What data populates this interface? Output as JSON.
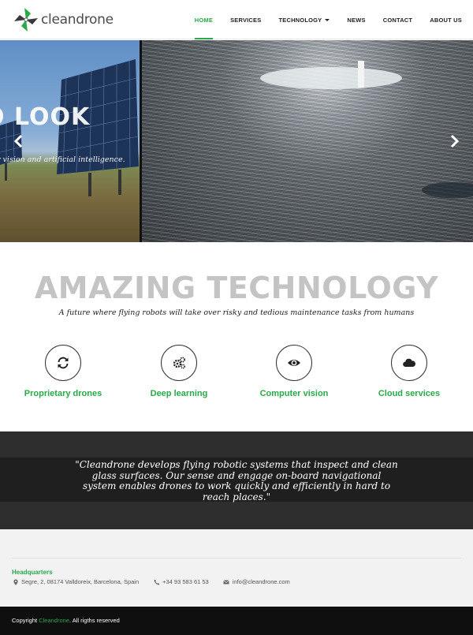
{
  "brand": {
    "name": "cleandrone"
  },
  "nav": {
    "items": [
      {
        "label": "HOME",
        "active": true
      },
      {
        "label": "SERVICES"
      },
      {
        "label": "TECHNOLOGY",
        "dropdown": true
      },
      {
        "label": "NEWS"
      },
      {
        "label": "CONTACT"
      },
      {
        "label": "ABOUT US"
      }
    ]
  },
  "hero": {
    "title": "O LOOK",
    "subtitle": "r vision and artificial intelligence.",
    "prev_icon": "chevron-left-icon",
    "next_icon": "chevron-right-icon"
  },
  "features": {
    "title": "AMAZING TECHNOLOGY",
    "subtitle": "A future where flying robots will take over risky and tedious maintenance tasks from humans",
    "items": [
      {
        "label": "Proprietary drones",
        "icon": "refresh-icon"
      },
      {
        "label": "Deep learning",
        "icon": "gears-icon"
      },
      {
        "label": "Computer vision",
        "icon": "eye-icon"
      },
      {
        "label": "Cloud services",
        "icon": "cloud-icon"
      }
    ]
  },
  "quote": {
    "text": "\"Cleandrone develops flying robotic systems that inspect and clean glass surfaces. Our sense and engage on-board navigational system enables drones to work quickly and efficiently in hard to reach places.\""
  },
  "footer": {
    "hq_title": "Headquarters",
    "address": "Segre, 2, 08174 Valldoreix, Barcelona, Spain",
    "phone": "+34 93 583 61 53",
    "email": "info@cleandrone.com"
  },
  "copyright": {
    "prefix": "Copyright ",
    "brand": "Cleandrone",
    "suffix": ". All rigths reserved"
  },
  "colors": {
    "accent": "#2aa84a",
    "dark_band": "#2e2e2e",
    "title_gray": "#c4c4c4"
  }
}
